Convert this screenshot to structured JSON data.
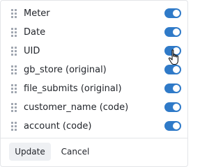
{
  "columns": {
    "items": [
      {
        "label": "Meter",
        "enabled": true
      },
      {
        "label": "Date",
        "enabled": true
      },
      {
        "label": "UID",
        "enabled": true
      },
      {
        "label": "gb_store (original)",
        "enabled": true
      },
      {
        "label": "file_submits (original)",
        "enabled": true
      },
      {
        "label": "customer_name (code)",
        "enabled": true
      },
      {
        "label": "account (code)",
        "enabled": true
      }
    ]
  },
  "footer": {
    "update_label": "Update",
    "cancel_label": "Cancel"
  },
  "colors": {
    "toggle_on": "#2f7ac8",
    "text": "#22252b",
    "handle": "#a0a6b0"
  },
  "icons": {
    "drag": "drag-handle-icon",
    "cursor": "hand-pointer-icon"
  }
}
